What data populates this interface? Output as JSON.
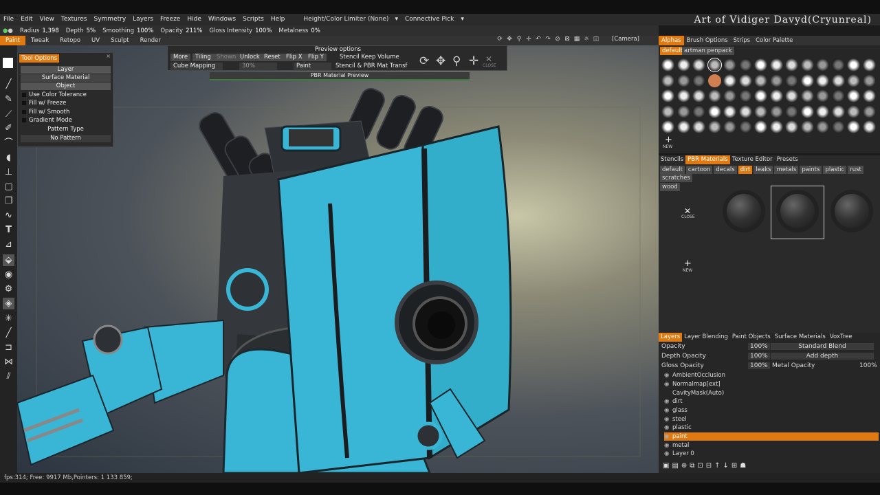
{
  "menu": {
    "items": [
      "File",
      "Edit",
      "View",
      "Textures",
      "Symmetry",
      "Layers",
      "Freeze",
      "Hide",
      "Windows",
      "Scripts",
      "Help"
    ],
    "height_limiter": "Height/Color Limiter (None)",
    "pick_mode": "Connective Pick",
    "brand": "Art of Vidiger Davyd(Cryunreal)"
  },
  "params": [
    {
      "label": "Radius",
      "value": "1,398"
    },
    {
      "label": "Depth",
      "value": "5%"
    },
    {
      "label": "Smoothing",
      "value": "100%"
    },
    {
      "label": "Opacity",
      "value": "211%"
    },
    {
      "label": "Gloss Intensity",
      "value": "100%"
    },
    {
      "label": "Metalness",
      "value": "0%"
    }
  ],
  "room_tabs": [
    "Paint",
    "Tweak",
    "Retopo",
    "UV",
    "Sculpt",
    "Render"
  ],
  "camera": "[Camera]",
  "tool_options": {
    "header": "Tool Options",
    "layer": "Layer",
    "surface_material": "Surface Material",
    "object": "Object",
    "use_color_tolerance": "Use Color Tolerance",
    "fill_freeze": "Fill w/ Freeze",
    "fill_smooth": "Fill w/ Smooth",
    "gradient_mode": "Gradient Mode",
    "pattern_type": "Pattern Type",
    "pattern_value": "No Pattern"
  },
  "preview_options": {
    "title": "Preview options",
    "more": "More",
    "tiling": "Tiling",
    "shown": "Shown",
    "unlock": "Unlock",
    "reset": "Reset",
    "flip_x": "Flip X",
    "flip_y": "Flip Y",
    "stencil_keep_volume": "Stencil Keep Volume",
    "cube_mapping": "Cube Mapping",
    "percent": "30%",
    "paint": "Paint",
    "stencil_pbr": "Stencil & PBR Mat Transf",
    "close": "CLOSE"
  },
  "pbr_preview": "PBR Material Preview",
  "right_panel": {
    "top_tabs": [
      "Alphas",
      "Brush Options",
      "Strips",
      "Color Palette"
    ],
    "alpha_sets": [
      "default",
      "artman penpack"
    ],
    "new_label": "NEW",
    "mid_tabs": [
      "Stencils",
      "PBR Materials",
      "Texture Editor",
      "Presets"
    ],
    "pbr_sets": [
      "default",
      "cartoon",
      "decals",
      "dirt",
      "leaks",
      "metals",
      "paints",
      "plastic",
      "rust",
      "scratches",
      "wood"
    ],
    "close_label": "CLOSE"
  },
  "layers_panel": {
    "tabs": [
      "Layers",
      "Layer Blending",
      "Paint Objects",
      "Surface Materials",
      "VoxTree"
    ],
    "opacity_label": "Opacity",
    "opacity_value": "100%",
    "blend_mode": "Standard Blend",
    "depth_opacity_label": "Depth Opacity",
    "depth_opacity_value": "100%",
    "add_depth": "Add depth",
    "gloss_opacity_label": "Gloss Opacity",
    "gloss_opacity_value": "100%",
    "metal_opacity_label": "Metal Opacity",
    "metal_opacity_value": "100%",
    "layers": [
      "AmbientOcclusion",
      "Normalmap[ext]",
      "CavityMask(Auto)",
      "dirt",
      "glass",
      "steel",
      "plastic",
      "paint",
      "metal",
      "Layer 0"
    ],
    "selected": "paint"
  },
  "status": "fps:314;    Free: 9917 Mb,Pointers: 1 133 859;",
  "colors": {
    "accent": "#e07a10",
    "robot_blue": "#39b6d6"
  }
}
